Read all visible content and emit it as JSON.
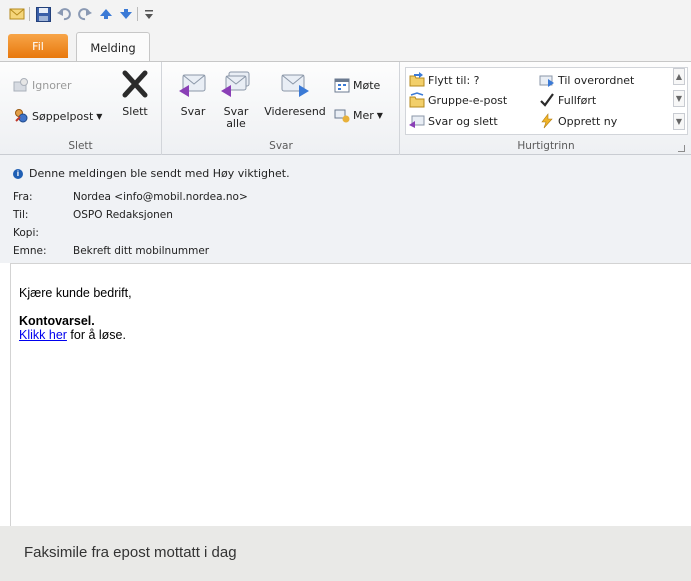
{
  "quick_access": {
    "icons": [
      "email-icon",
      "save-icon",
      "undo-icon",
      "redo-icon",
      "previous-icon",
      "next-icon",
      "customize-icon"
    ]
  },
  "tabs": {
    "file": "Fil",
    "message": "Melding"
  },
  "ribbon": {
    "delete_group": {
      "ignore": "Ignorer",
      "junk": "Søppelpost",
      "delete": "Slett",
      "label": "Slett"
    },
    "respond_group": {
      "reply": "Svar",
      "reply_all_line1": "Svar",
      "reply_all_line2": "alle",
      "forward": "Videresend",
      "meeting": "Møte",
      "more": "Mer",
      "label": "Svar"
    },
    "quick_steps": {
      "move_to": "Flytt til: ?",
      "team_email": "Gruppe-e-post",
      "reply_delete": "Svar og slett",
      "to_manager": "Til overordnet",
      "done": "Fullført",
      "create_new": "Opprett ny",
      "label": "Hurtigtrinn"
    }
  },
  "header": {
    "notice": "Denne meldingen ble sendt med Høy viktighet.",
    "from_label": "Fra:",
    "from_value": "Nordea <info@mobil.nordea.no>",
    "to_label": "Til:",
    "to_value": "OSPO Redaksjonen",
    "cc_label": "Kopi:",
    "cc_value": "",
    "subject_label": "Emne:",
    "subject_value": "Bekreft ditt mobilnummer"
  },
  "body": {
    "greeting": "Kjære kunde bedrift,",
    "heading": "Kontovarsel.",
    "link": "Klikk her",
    "link_suffix": " for å løse."
  },
  "caption": "Faksimile fra epost mottatt i dag",
  "colors": {
    "file_tab": "#e8780d",
    "link": "#0000ee",
    "info": "#1f5fb4"
  }
}
